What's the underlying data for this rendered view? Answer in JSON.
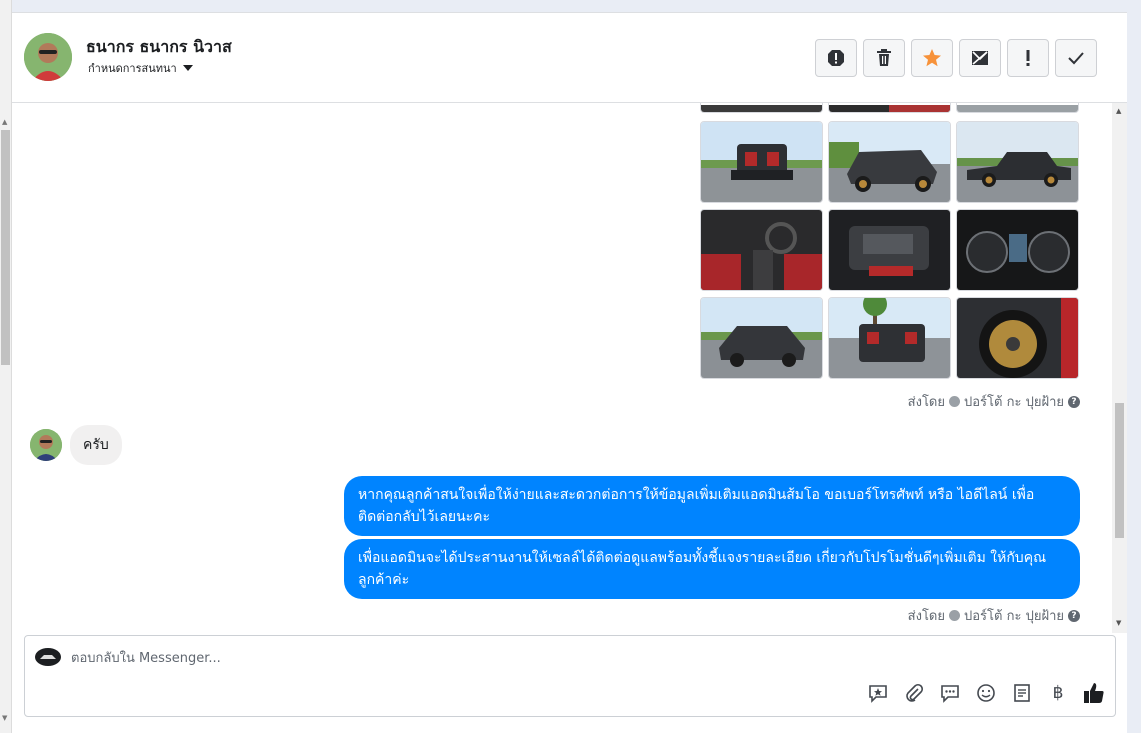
{
  "contact": {
    "name": "ธนากร ธนากร นิวาส",
    "assign_label": "กำหนดการสนทนา"
  },
  "actions": [
    {
      "name": "report-icon"
    },
    {
      "name": "trash-icon"
    },
    {
      "name": "star-icon"
    },
    {
      "name": "mark-unread-icon"
    },
    {
      "name": "exclamation-icon"
    },
    {
      "name": "check-icon"
    }
  ],
  "thread": {
    "sent_by_label": "ส่งโดย",
    "sender": "ปอร์โต้ กะ ปุยฝ้าย",
    "help_glyph": "?",
    "incoming_message": "ครับ",
    "outgoing_messages": [
      "หากคุณลูกค้าสนใจเพื่อให้ง่ายและสะดวกต่อการให้ข้อมูลเพิ่มเติมแอดมินส้มโอ ขอเบอร์โทรศัพท์ หรือ ไอดีไลน์ เพื่อติดต่อกลับไว้เลยนะคะ",
      "เพื่อแอดมินจะได้ประสานงานให้เซลล์ได้ติดต่อดูแลพร้อมทั้งชี้แจงรายละเอียด เกี่ยวกับโปรโมชั่นดีๆเพิ่มเติม ให้กับคุณลูกค้าค่ะ"
    ]
  },
  "composer": {
    "placeholder": "ตอบกลับใน Messenger...",
    "tools": [
      "saved-reply-icon",
      "attach-icon",
      "chat-icon",
      "emoji-icon",
      "notes-icon",
      "baht-icon",
      "like-icon"
    ],
    "baht_glyph": "฿"
  },
  "colors": {
    "accent": "#0084ff",
    "star": "#f7923a"
  }
}
